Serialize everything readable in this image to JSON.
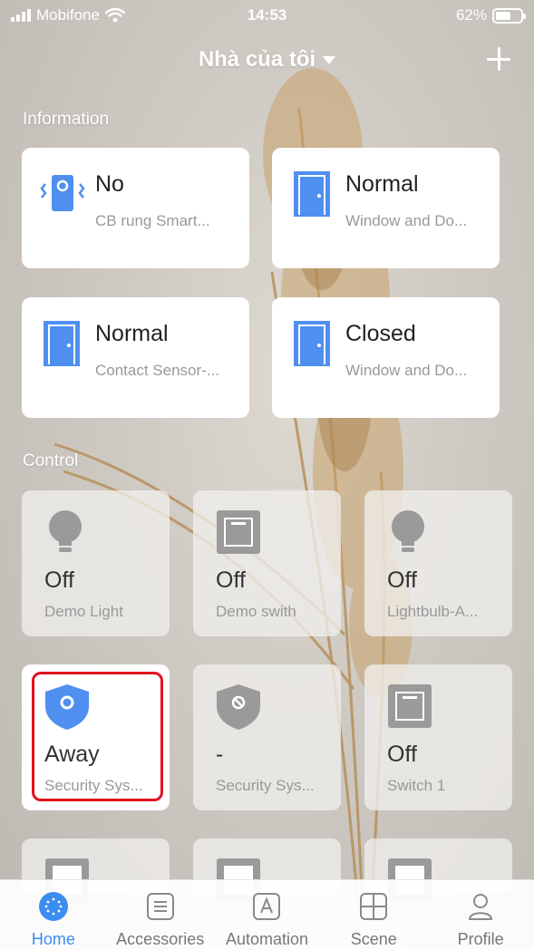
{
  "status_bar": {
    "carrier": "Mobifone",
    "time": "14:53",
    "battery": "62%",
    "battery_level": 0.62
  },
  "header": {
    "title": "Nhà của tôi"
  },
  "sections": {
    "information": "Information",
    "control": "Control"
  },
  "info_cards": [
    {
      "status": "No",
      "subtitle": "CB rung Smart...",
      "icon": "vibration-sensor-icon"
    },
    {
      "status": "Normal",
      "subtitle": "Window and Do...",
      "icon": "door-icon"
    },
    {
      "status": "Normal",
      "subtitle": "Contact Sensor-...",
      "icon": "door-icon"
    },
    {
      "status": "Closed",
      "subtitle": "Window and Do...",
      "icon": "door-icon"
    }
  ],
  "control_cards": [
    {
      "status": "Off",
      "subtitle": "Demo Light",
      "icon": "lightbulb-icon"
    },
    {
      "status": "Off",
      "subtitle": "Demo swith",
      "icon": "switch-icon"
    },
    {
      "status": "Off",
      "subtitle": "Lightbulb-A...",
      "icon": "lightbulb-icon"
    },
    {
      "status": "Away",
      "subtitle": "Security Sys...",
      "icon": "security-shield-icon"
    },
    {
      "status": "-",
      "subtitle": "Security Sys...",
      "icon": "security-shield-off-icon"
    },
    {
      "status": "Off",
      "subtitle": "Switch 1",
      "icon": "switch-icon"
    }
  ],
  "tabs": [
    {
      "label": "Home",
      "icon": "home-icon",
      "active": true
    },
    {
      "label": "Accessories",
      "icon": "accessories-icon"
    },
    {
      "label": "Automation",
      "icon": "automation-icon"
    },
    {
      "label": "Scene",
      "icon": "scene-icon"
    },
    {
      "label": "Profile",
      "icon": "profile-icon"
    }
  ],
  "colors": {
    "accent": "#3b8df0",
    "icon_blue": "#4e8ff0",
    "highlight": "#e2121e",
    "icon_gray": "#9a9a9a"
  }
}
